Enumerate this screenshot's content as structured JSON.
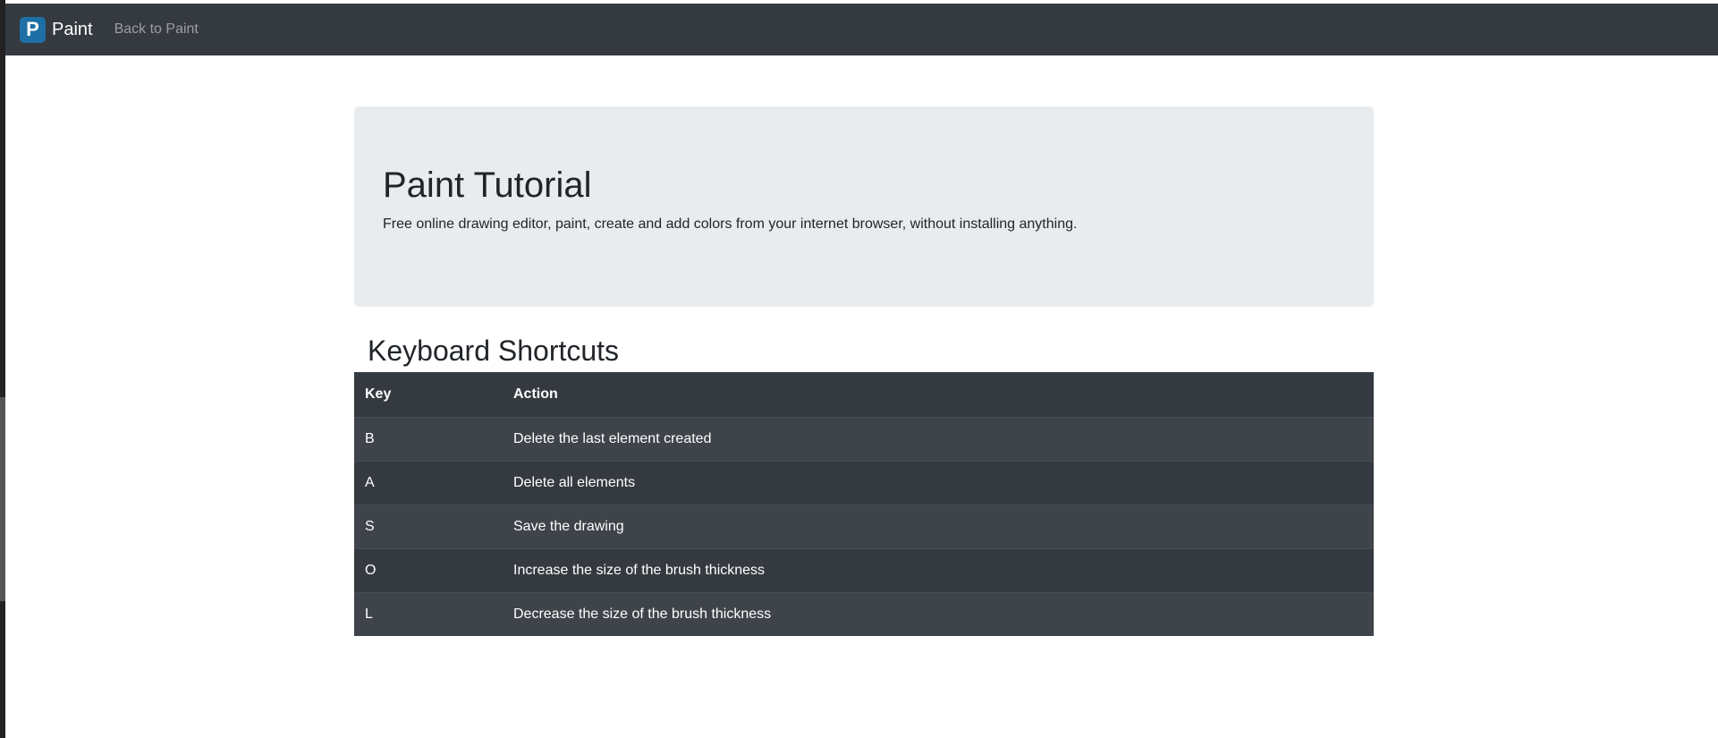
{
  "navbar": {
    "logo_letter": "P",
    "brand": "Paint",
    "back_link": "Back to Paint"
  },
  "jumbotron": {
    "title": "Paint Tutorial",
    "description": "Free online drawing editor, paint, create and add colors from your internet browser, without installing anything."
  },
  "shortcuts": {
    "title": "Keyboard Shortcuts",
    "headers": [
      "Key",
      "Action"
    ],
    "rows": [
      {
        "key": "B",
        "action": "Delete the last element created"
      },
      {
        "key": "A",
        "action": "Delete all elements"
      },
      {
        "key": "S",
        "action": "Save the drawing"
      },
      {
        "key": "O",
        "action": "Increase the size of the brush thickness"
      },
      {
        "key": "L",
        "action": "Decrease the size of the brush thickness"
      }
    ]
  },
  "colors": {
    "navbar_bg": "#343a40",
    "logo_bg": "#1d6fa5",
    "jumbotron_bg": "#e9ecef",
    "table_row_dark": "#343a40",
    "table_row_light": "#3e444a"
  }
}
